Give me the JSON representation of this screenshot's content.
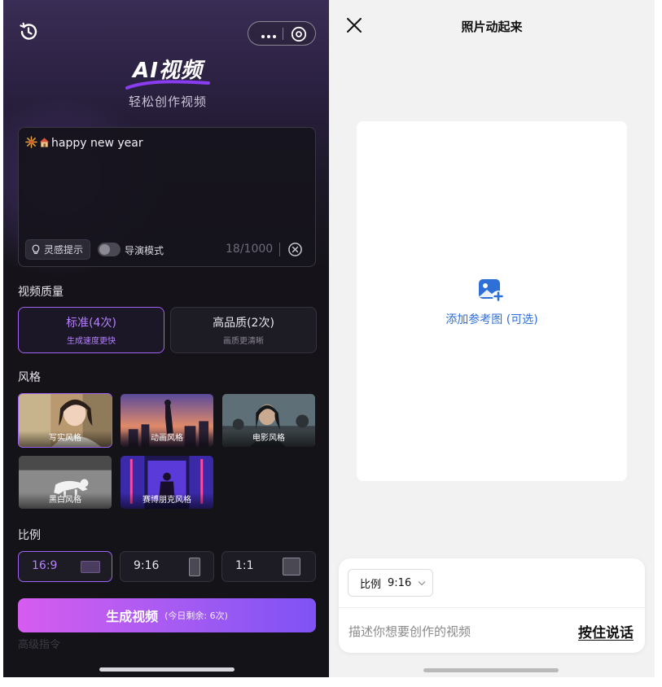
{
  "left": {
    "logo_title": "AI视频",
    "logo_subtitle": "轻松创作视频",
    "prompt_text": "happy new year",
    "inspire_label": "灵感提示",
    "director_label": "导演模式",
    "char_counter": "18/1000",
    "quality_section": "视频质量",
    "quality_options": [
      {
        "title": "标准(4次)",
        "sub": "生成速度更快",
        "selected": true
      },
      {
        "title": "高品质(2次)",
        "sub": "画质更清晰",
        "selected": false
      }
    ],
    "style_section": "风格",
    "styles": [
      {
        "label": "写实风格",
        "selected": true
      },
      {
        "label": "动画风格",
        "selected": false
      },
      {
        "label": "电影风格",
        "selected": false
      },
      {
        "label": "黑白风格",
        "selected": false
      },
      {
        "label": "赛博朋克风格",
        "selected": false
      }
    ],
    "ratio_section": "比例",
    "ratios": [
      {
        "label": "16:9",
        "selected": true
      },
      {
        "label": "9:16",
        "selected": false
      },
      {
        "label": "1:1",
        "selected": false
      }
    ],
    "advanced_label": "高级指令",
    "generate_label": "生成视频",
    "generate_remaining": "(今日剩余: 6次)",
    "accent_color": "#a064f5"
  },
  "right": {
    "title": "照片动起来",
    "upload_label": "添加参考图 (可选)",
    "ratio_chip_label": "比例",
    "ratio_chip_value": "9:16",
    "description_placeholder": "描述你想要创作的视频",
    "voice_button": "按住说话",
    "accent_color": "#2f6fd8"
  }
}
